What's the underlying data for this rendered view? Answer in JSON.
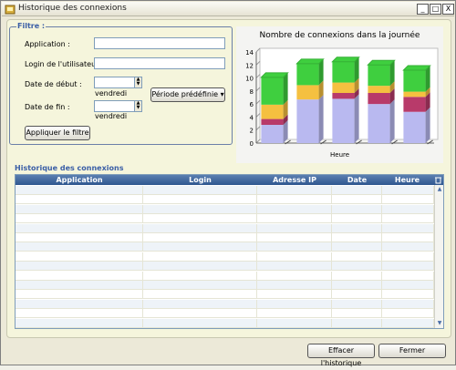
{
  "window": {
    "title": "Historique des connexions",
    "controls": {
      "minimize": "_",
      "maximize": "□",
      "close": "X"
    }
  },
  "filter": {
    "legend": "Filtre :",
    "application_label": "Application :",
    "application_value": "",
    "login_label": "Login de l'utilisateur :",
    "login_value": "",
    "start_label": "Date de début :",
    "start_day": "vendredi",
    "end_label": "Date de fin :",
    "end_day": "vendredi",
    "period_button": "Période prédéfinie",
    "apply_button": "Appliquer le filtre"
  },
  "chart_data": {
    "type": "bar",
    "stacked": true,
    "title": "Nombre de connexions dans la journée",
    "xlabel": "Heure",
    "ylabel": "",
    "ylim": [
      0,
      14
    ],
    "yticks": [
      0,
      2,
      4,
      6,
      8,
      10,
      12,
      14
    ],
    "categories": [
      "1",
      "2",
      "3",
      "4",
      "5"
    ],
    "series": [
      {
        "values": [
          2.8,
          6.7,
          6.8,
          6.0,
          4.8
        ],
        "color": "#b9b9f0"
      },
      {
        "values": [
          0.9,
          0,
          0.9,
          1.7,
          2.3
        ],
        "color": "#b83a6a"
      },
      {
        "values": [
          2.2,
          2.2,
          1.6,
          1.1,
          0.8
        ],
        "color": "#f5c040"
      },
      {
        "values": [
          4.2,
          3.3,
          3.2,
          3.2,
          3.3
        ],
        "color": "#3fcf3f"
      }
    ]
  },
  "history": {
    "section_title": "Historique des connexions",
    "columns": [
      "Application",
      "Login",
      "Adresse IP",
      "Date",
      "Heure"
    ]
  },
  "footer": {
    "clear_button": "Effacer l'historique",
    "close_button": "Fermer"
  },
  "colors": {
    "accent": "#3a5ea6",
    "header": "#2f578f"
  }
}
